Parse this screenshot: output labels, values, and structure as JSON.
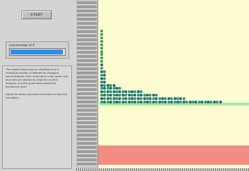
{
  "controls": {
    "run_label": "START",
    "slider_label": "concentration of A",
    "slider_level": 0.97
  },
  "info": {
    "paragraph1": "This model shows how the equilibrium of a reversible reaction is affected by changing concentrations. Each molecule is a dot; green and blue dots are stacked to show the current amounts, and the green band marks the equilibrium level.",
    "paragraph2": "Adjust the slider and press the button to start the simulation."
  },
  "plot": {
    "colors": {
      "background": "#fcfcd0",
      "band": "#f28c82",
      "equilibrium": "#a8e8a0",
      "green_dots": "#2e9e50",
      "blue_dots": "#1e5fa8"
    },
    "dot_counts": [
      22,
      10,
      6,
      6,
      6,
      5,
      5,
      4,
      4,
      4,
      4,
      4,
      4,
      4,
      3,
      3,
      3,
      3,
      3,
      2,
      2,
      2,
      2,
      2,
      2,
      2,
      2,
      2,
      1,
      1,
      1,
      1,
      1,
      1,
      1,
      1,
      1,
      1,
      1,
      1
    ]
  },
  "icons": {
    "cursor": "mouse-pointer-icon"
  }
}
